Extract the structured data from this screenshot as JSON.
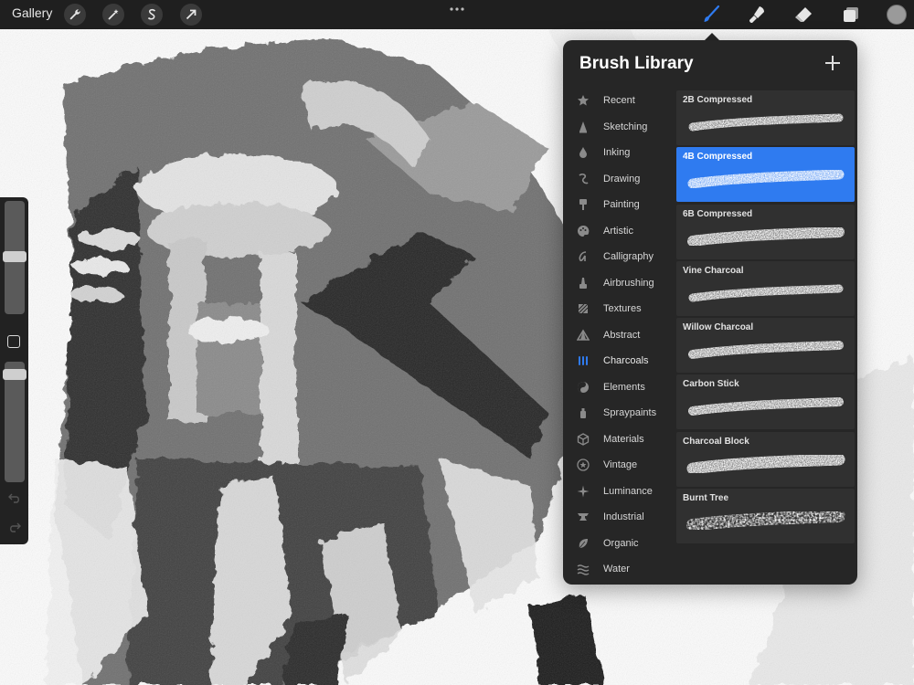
{
  "toolbar": {
    "gallery_label": "Gallery",
    "actions_icon": "wrench-icon",
    "adjustments_icon": "magic-wand-icon",
    "selection_icon": "selection-s-icon",
    "transform_icon": "arrow-icon",
    "brush_icon": "brush-icon",
    "smudge_icon": "smudge-icon",
    "eraser_icon": "eraser-icon",
    "layers_icon": "layers-icon",
    "active_tool_color": "#2f7bf0",
    "current_color": "#9a9a9a"
  },
  "sidebar": {
    "brush_size_level": 0.5,
    "opacity_level": 0.05,
    "modify_icon": "square-icon",
    "undo_icon": "undo-icon",
    "redo_icon": "redo-icon"
  },
  "brush_library": {
    "title": "Brush Library",
    "add_icon": "plus-icon",
    "categories": [
      {
        "label": "Recent",
        "icon": "star-icon"
      },
      {
        "label": "Sketching",
        "icon": "pencil-tip-icon"
      },
      {
        "label": "Inking",
        "icon": "ink-drop-icon"
      },
      {
        "label": "Drawing",
        "icon": "squiggle-icon"
      },
      {
        "label": "Painting",
        "icon": "paintbrush-icon"
      },
      {
        "label": "Artistic",
        "icon": "palette-icon"
      },
      {
        "label": "Calligraphy",
        "icon": "calligraphy-icon"
      },
      {
        "label": "Airbrushing",
        "icon": "airbrush-icon"
      },
      {
        "label": "Textures",
        "icon": "texture-icon"
      },
      {
        "label": "Abstract",
        "icon": "triangle-icon"
      },
      {
        "label": "Charcoals",
        "icon": "charcoal-sticks-icon"
      },
      {
        "label": "Elements",
        "icon": "yin-yang-icon"
      },
      {
        "label": "Spraypaints",
        "icon": "spray-can-icon"
      },
      {
        "label": "Materials",
        "icon": "cube-icon"
      },
      {
        "label": "Vintage",
        "icon": "vintage-star-icon"
      },
      {
        "label": "Luminance",
        "icon": "sparkle-icon"
      },
      {
        "label": "Industrial",
        "icon": "anvil-icon"
      },
      {
        "label": "Organic",
        "icon": "leaf-icon"
      },
      {
        "label": "Water",
        "icon": "waves-icon"
      }
    ],
    "active_category": "Charcoals",
    "accent_color": "#2f7bf0",
    "brushes": [
      {
        "name": "2B Compressed",
        "selected": false
      },
      {
        "name": "4B Compressed",
        "selected": true
      },
      {
        "name": "6B Compressed",
        "selected": false
      },
      {
        "name": "Vine Charcoal",
        "selected": false
      },
      {
        "name": "Willow Charcoal",
        "selected": false
      },
      {
        "name": "Carbon Stick",
        "selected": false
      },
      {
        "name": "Charcoal Block",
        "selected": false
      },
      {
        "name": "Burnt Tree",
        "selected": false
      }
    ]
  }
}
